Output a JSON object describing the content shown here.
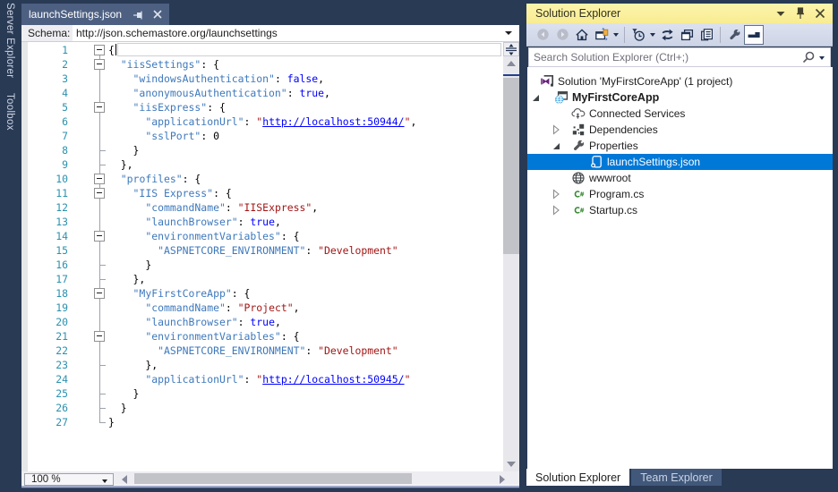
{
  "colors": {
    "window_bg": "#293A55",
    "doc_tab_bg": "#4D6082",
    "tool_title_bg": "#FBF0A0",
    "selection_blue": "#0078D7",
    "json_key": "#3E79BC",
    "json_string": "#A31515",
    "json_keyword": "#0000FF",
    "line_number": "#2B91AF"
  },
  "sidebar": {
    "items": [
      {
        "label": "Server Explorer"
      },
      {
        "label": "Toolbox"
      }
    ]
  },
  "editor": {
    "tab": {
      "title": "launchSettings.json",
      "icons": [
        "pin-icon",
        "close-icon"
      ]
    },
    "schema": {
      "label": "Schema:",
      "value": "http://json.schemastore.org/launchsettings"
    },
    "zoom_level": "100 %",
    "lines": [
      {
        "num": 1,
        "fold": true,
        "tick": false,
        "segs": [
          [
            "{",
            "p"
          ]
        ]
      },
      {
        "num": 2,
        "fold": true,
        "tick": false,
        "segs": [
          [
            "  ",
            "p"
          ],
          [
            "\"iisSettings\"",
            "k"
          ],
          [
            ": {",
            "p"
          ]
        ]
      },
      {
        "num": 3,
        "fold": false,
        "tick": false,
        "segs": [
          [
            "    ",
            "p"
          ],
          [
            "\"windowsAuthentication\"",
            "k"
          ],
          [
            ": ",
            "p"
          ],
          [
            "false",
            "b"
          ],
          [
            ",",
            "p"
          ]
        ]
      },
      {
        "num": 4,
        "fold": false,
        "tick": false,
        "segs": [
          [
            "    ",
            "p"
          ],
          [
            "\"anonymousAuthentication\"",
            "k"
          ],
          [
            ": ",
            "p"
          ],
          [
            "true",
            "b"
          ],
          [
            ",",
            "p"
          ]
        ]
      },
      {
        "num": 5,
        "fold": true,
        "tick": false,
        "segs": [
          [
            "    ",
            "p"
          ],
          [
            "\"iisExpress\"",
            "k"
          ],
          [
            ": {",
            "p"
          ]
        ]
      },
      {
        "num": 6,
        "fold": false,
        "tick": false,
        "segs": [
          [
            "      ",
            "p"
          ],
          [
            "\"applicationUrl\"",
            "k"
          ],
          [
            ": ",
            "p"
          ],
          [
            "\"",
            "s"
          ],
          [
            "http://localhost:50944/",
            "u"
          ],
          [
            "\"",
            "s"
          ],
          [
            ",",
            "p"
          ]
        ]
      },
      {
        "num": 7,
        "fold": false,
        "tick": false,
        "segs": [
          [
            "      ",
            "p"
          ],
          [
            "\"sslPort\"",
            "k"
          ],
          [
            ": ",
            "p"
          ],
          [
            "0",
            "n"
          ]
        ]
      },
      {
        "num": 8,
        "fold": false,
        "tick": true,
        "segs": [
          [
            "    }",
            "p"
          ]
        ]
      },
      {
        "num": 9,
        "fold": false,
        "tick": true,
        "segs": [
          [
            "  },",
            "p"
          ]
        ]
      },
      {
        "num": 10,
        "fold": true,
        "tick": false,
        "segs": [
          [
            "  ",
            "p"
          ],
          [
            "\"profiles\"",
            "k"
          ],
          [
            ": {",
            "p"
          ]
        ]
      },
      {
        "num": 11,
        "fold": true,
        "tick": false,
        "segs": [
          [
            "    ",
            "p"
          ],
          [
            "\"IIS Express\"",
            "k"
          ],
          [
            ": {",
            "p"
          ]
        ]
      },
      {
        "num": 12,
        "fold": false,
        "tick": false,
        "segs": [
          [
            "      ",
            "p"
          ],
          [
            "\"commandName\"",
            "k"
          ],
          [
            ": ",
            "p"
          ],
          [
            "\"IISExpress\"",
            "s"
          ],
          [
            ",",
            "p"
          ]
        ]
      },
      {
        "num": 13,
        "fold": false,
        "tick": false,
        "segs": [
          [
            "      ",
            "p"
          ],
          [
            "\"launchBrowser\"",
            "k"
          ],
          [
            ": ",
            "p"
          ],
          [
            "true",
            "b"
          ],
          [
            ",",
            "p"
          ]
        ]
      },
      {
        "num": 14,
        "fold": true,
        "tick": false,
        "segs": [
          [
            "      ",
            "p"
          ],
          [
            "\"environmentVariables\"",
            "k"
          ],
          [
            ": {",
            "p"
          ]
        ]
      },
      {
        "num": 15,
        "fold": false,
        "tick": false,
        "segs": [
          [
            "        ",
            "p"
          ],
          [
            "\"ASPNETCORE_ENVIRONMENT\"",
            "k"
          ],
          [
            ": ",
            "p"
          ],
          [
            "\"Development\"",
            "s"
          ]
        ]
      },
      {
        "num": 16,
        "fold": false,
        "tick": true,
        "segs": [
          [
            "      }",
            "p"
          ]
        ]
      },
      {
        "num": 17,
        "fold": false,
        "tick": true,
        "segs": [
          [
            "    },",
            "p"
          ]
        ]
      },
      {
        "num": 18,
        "fold": true,
        "tick": false,
        "segs": [
          [
            "    ",
            "p"
          ],
          [
            "\"MyFirstCoreApp\"",
            "k"
          ],
          [
            ": {",
            "p"
          ]
        ]
      },
      {
        "num": 19,
        "fold": false,
        "tick": false,
        "segs": [
          [
            "      ",
            "p"
          ],
          [
            "\"commandName\"",
            "k"
          ],
          [
            ": ",
            "p"
          ],
          [
            "\"Project\"",
            "s"
          ],
          [
            ",",
            "p"
          ]
        ]
      },
      {
        "num": 20,
        "fold": false,
        "tick": false,
        "segs": [
          [
            "      ",
            "p"
          ],
          [
            "\"launchBrowser\"",
            "k"
          ],
          [
            ": ",
            "p"
          ],
          [
            "true",
            "b"
          ],
          [
            ",",
            "p"
          ]
        ]
      },
      {
        "num": 21,
        "fold": true,
        "tick": false,
        "segs": [
          [
            "      ",
            "p"
          ],
          [
            "\"environmentVariables\"",
            "k"
          ],
          [
            ": {",
            "p"
          ]
        ]
      },
      {
        "num": 22,
        "fold": false,
        "tick": false,
        "segs": [
          [
            "        ",
            "p"
          ],
          [
            "\"ASPNETCORE_ENVIRONMENT\"",
            "k"
          ],
          [
            ": ",
            "p"
          ],
          [
            "\"Development\"",
            "s"
          ]
        ]
      },
      {
        "num": 23,
        "fold": false,
        "tick": true,
        "segs": [
          [
            "      },",
            "p"
          ]
        ]
      },
      {
        "num": 24,
        "fold": false,
        "tick": false,
        "segs": [
          [
            "      ",
            "p"
          ],
          [
            "\"applicationUrl\"",
            "k"
          ],
          [
            ": ",
            "p"
          ],
          [
            "\"",
            "s"
          ],
          [
            "http://localhost:50945/",
            "u"
          ],
          [
            "\"",
            "s"
          ]
        ]
      },
      {
        "num": 25,
        "fold": false,
        "tick": true,
        "segs": [
          [
            "    }",
            "p"
          ]
        ]
      },
      {
        "num": 26,
        "fold": false,
        "tick": true,
        "segs": [
          [
            "  }",
            "p"
          ]
        ]
      },
      {
        "num": 27,
        "fold": false,
        "tick": true,
        "segs": [
          [
            "}",
            "p"
          ]
        ]
      }
    ]
  },
  "solution_explorer": {
    "title": "Solution Explorer",
    "window_buttons": [
      "window-position-icon",
      "pin-icon",
      "close-icon"
    ],
    "toolbar": [
      {
        "type": "button",
        "name": "back",
        "icon": "back-circle-icon",
        "disabled": true
      },
      {
        "type": "button",
        "name": "forward",
        "icon": "forward-circle-icon",
        "disabled": true
      },
      {
        "type": "button",
        "name": "home",
        "icon": "home-icon"
      },
      {
        "type": "button",
        "name": "switch-views",
        "icon": "switch-views-icon",
        "dropdown": true
      },
      {
        "type": "separator"
      },
      {
        "type": "button",
        "name": "pending-changes-filter",
        "icon": "filter-clock-icon",
        "dropdown": true
      },
      {
        "type": "button",
        "name": "sync-with-active-document",
        "icon": "sync-arrows-icon"
      },
      {
        "type": "button",
        "name": "collapse-all",
        "icon": "collapse-all-icon"
      },
      {
        "type": "button",
        "name": "show-all-files",
        "icon": "show-all-files-icon"
      },
      {
        "type": "separator"
      },
      {
        "type": "button",
        "name": "properties",
        "icon": "wrench-icon"
      },
      {
        "type": "button",
        "name": "preview-selected-items",
        "icon": "preview-items-icon",
        "pressed": true
      }
    ],
    "search": {
      "placeholder": "Search Solution Explorer (Ctrl+;)",
      "icons": [
        "search-icon",
        "chevron-down-icon"
      ]
    },
    "tree": [
      {
        "label": "Solution 'MyFirstCoreApp' (1 project)",
        "icon": "solution",
        "indent": 0,
        "expander": "none",
        "bold": false,
        "selected": false
      },
      {
        "label": "MyFirstCoreApp",
        "icon": "project",
        "indent": 1,
        "expander": "expanded",
        "bold": true,
        "selected": false
      },
      {
        "label": "Connected Services",
        "icon": "connected-services",
        "indent": 2,
        "expander": "none",
        "bold": false,
        "selected": false
      },
      {
        "label": "Dependencies",
        "icon": "dependencies",
        "indent": 2,
        "expander": "collapsed",
        "bold": false,
        "selected": false
      },
      {
        "label": "Properties",
        "icon": "properties-wrench",
        "indent": 2,
        "expander": "expanded",
        "bold": false,
        "selected": false
      },
      {
        "label": "launchSettings.json",
        "icon": "json-file",
        "indent": 3,
        "expander": "none",
        "bold": false,
        "selected": true
      },
      {
        "label": "wwwroot",
        "icon": "globe",
        "indent": 2,
        "expander": "none",
        "bold": false,
        "selected": false
      },
      {
        "label": "Program.cs",
        "icon": "csharp-file",
        "indent": 2,
        "expander": "collapsed",
        "bold": false,
        "selected": false
      },
      {
        "label": "Startup.cs",
        "icon": "csharp-file",
        "indent": 2,
        "expander": "collapsed",
        "bold": false,
        "selected": false
      }
    ],
    "bottom_tabs": [
      {
        "label": "Solution Explorer",
        "active": true
      },
      {
        "label": "Team Explorer",
        "active": false
      }
    ]
  }
}
